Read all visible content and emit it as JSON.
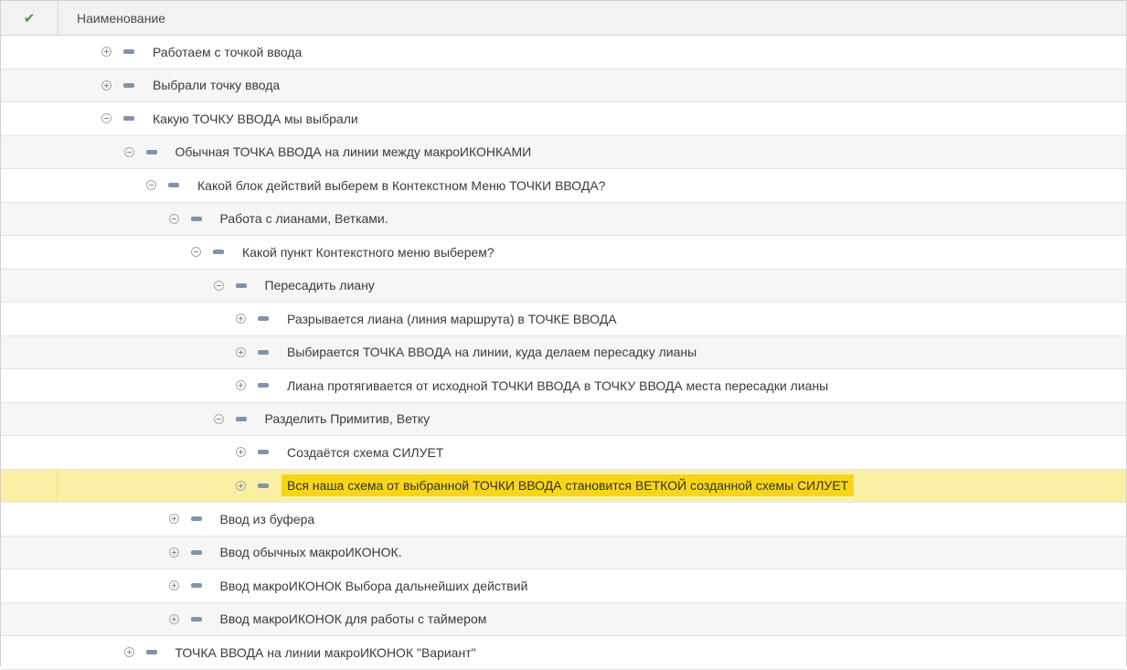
{
  "header": {
    "check_icon": "✔",
    "name_label": "Наименование"
  },
  "colors": {
    "header_bg": "#f2f2f2",
    "row_alt_bg": "#f6f6f6",
    "selected_row_bg": "#fbefa6",
    "selected_label_bg": "#f9d51a",
    "check_color": "#3aa54a",
    "node_dash_color": "#7f93ad"
  },
  "rows": [
    {
      "label": "Работаем с точкой ввода",
      "level": 0,
      "state": "collapsed"
    },
    {
      "label": "Выбрали точку ввода",
      "level": 0,
      "state": "collapsed"
    },
    {
      "label": "Какую ТОЧКУ ВВОДА мы выбрали",
      "level": 0,
      "state": "expanded"
    },
    {
      "label": "Обычная ТОЧКА ВВОДА на линии между макроИКОНКАМИ",
      "level": 1,
      "state": "expanded"
    },
    {
      "label": "Какой блок действий выберем в Контекстном Меню ТОЧКИ ВВОДА?",
      "level": 2,
      "state": "expanded"
    },
    {
      "label": "Работа с лианами, Ветками.",
      "level": 3,
      "state": "expanded"
    },
    {
      "label": "Какой пункт Контекстного меню выберем?",
      "level": 4,
      "state": "expanded"
    },
    {
      "label": "Пересадить лиану",
      "level": 5,
      "state": "expanded"
    },
    {
      "label": "Разрывается лиана (линия маршрута) в ТОЧКЕ ВВОДА",
      "level": 6,
      "state": "collapsed"
    },
    {
      "label": "Выбирается ТОЧКА ВВОДА на линии, куда делаем пересадку лианы",
      "level": 6,
      "state": "collapsed"
    },
    {
      "label": "Лиана протягивается от исходной ТОЧКИ ВВОДА в ТОЧКУ ВВОДА места пересадки лианы",
      "level": 6,
      "state": "collapsed"
    },
    {
      "label": "Разделить Примитив, Ветку",
      "level": 5,
      "state": "expanded"
    },
    {
      "label": "Создаётся схема СИЛУЕТ",
      "level": 6,
      "state": "collapsed"
    },
    {
      "label": "Вся наша схема от выбранной ТОЧКИ ВВОДА становится ВЕТКОЙ созданной схемы СИЛУЕТ",
      "level": 6,
      "state": "collapsed",
      "selected": true
    },
    {
      "label": "Ввод из буфера",
      "level": 3,
      "state": "collapsed"
    },
    {
      "label": "Ввод обычных макроИКОНОК.",
      "level": 3,
      "state": "collapsed"
    },
    {
      "label": "Ввод макроИКОНОК Выбора дальнейших действий",
      "level": 3,
      "state": "collapsed"
    },
    {
      "label": "Ввод макроИКОНОК для работы с таймером",
      "level": 3,
      "state": "collapsed"
    },
    {
      "label": "ТОЧКА ВВОДА на линии макроИКОНОК \"Вариант\"",
      "level": 1,
      "state": "collapsed"
    }
  ]
}
